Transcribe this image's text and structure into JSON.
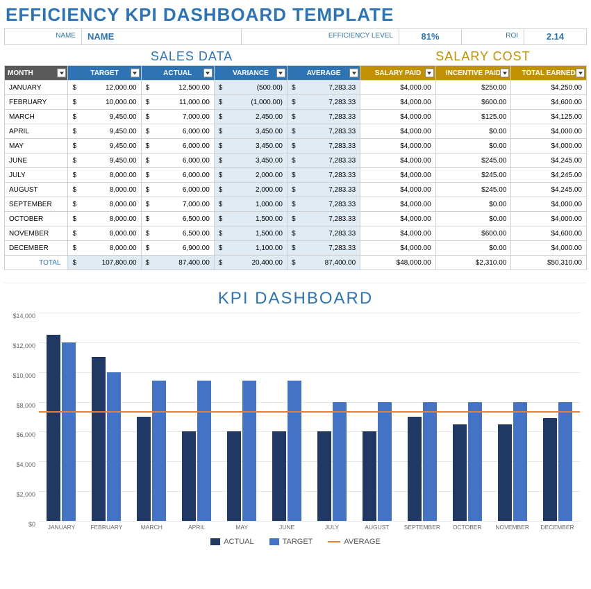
{
  "title": "EFFICIENCY KPI DASHBOARD TEMPLATE",
  "info": {
    "name_label": "NAME",
    "name_value": "NAME",
    "eff_label": "EFFICIENCY LEVEL",
    "eff_value": "81%",
    "roi_label": "ROI",
    "roi_value": "2.14"
  },
  "sections": {
    "sales": "SALES DATA",
    "salary": "SALARY COST"
  },
  "headers": {
    "month": "MONTH",
    "target": "TARGET",
    "actual": "ACTUAL",
    "variance": "VARIANCE",
    "average": "AVERAGE",
    "salary_paid": "SALARY PAID",
    "incentive": "INCENTIVE PAID",
    "total_earned": "TOTAL EARNED"
  },
  "rows": [
    {
      "month": "JANUARY",
      "target": "12,000.00",
      "actual": "12,500.00",
      "variance": "(500.00)",
      "average": "7,283.33",
      "salary": "$4,000.00",
      "incentive": "$250.00",
      "total": "$4,250.00"
    },
    {
      "month": "FEBRUARY",
      "target": "10,000.00",
      "actual": "11,000.00",
      "variance": "(1,000.00)",
      "average": "7,283.33",
      "salary": "$4,000.00",
      "incentive": "$600.00",
      "total": "$4,600.00"
    },
    {
      "month": "MARCH",
      "target": "9,450.00",
      "actual": "7,000.00",
      "variance": "2,450.00",
      "average": "7,283.33",
      "salary": "$4,000.00",
      "incentive": "$125.00",
      "total": "$4,125.00"
    },
    {
      "month": "APRIL",
      "target": "9,450.00",
      "actual": "6,000.00",
      "variance": "3,450.00",
      "average": "7,283.33",
      "salary": "$4,000.00",
      "incentive": "$0.00",
      "total": "$4,000.00"
    },
    {
      "month": "MAY",
      "target": "9,450.00",
      "actual": "6,000.00",
      "variance": "3,450.00",
      "average": "7,283.33",
      "salary": "$4,000.00",
      "incentive": "$0.00",
      "total": "$4,000.00"
    },
    {
      "month": "JUNE",
      "target": "9,450.00",
      "actual": "6,000.00",
      "variance": "3,450.00",
      "average": "7,283.33",
      "salary": "$4,000.00",
      "incentive": "$245.00",
      "total": "$4,245.00"
    },
    {
      "month": "JULY",
      "target": "8,000.00",
      "actual": "6,000.00",
      "variance": "2,000.00",
      "average": "7,283.33",
      "salary": "$4,000.00",
      "incentive": "$245.00",
      "total": "$4,245.00"
    },
    {
      "month": "AUGUST",
      "target": "8,000.00",
      "actual": "6,000.00",
      "variance": "2,000.00",
      "average": "7,283.33",
      "salary": "$4,000.00",
      "incentive": "$245.00",
      "total": "$4,245.00"
    },
    {
      "month": "SEPTEMBER",
      "target": "8,000.00",
      "actual": "7,000.00",
      "variance": "1,000.00",
      "average": "7,283.33",
      "salary": "$4,000.00",
      "incentive": "$0.00",
      "total": "$4,000.00"
    },
    {
      "month": "OCTOBER",
      "target": "8,000.00",
      "actual": "6,500.00",
      "variance": "1,500.00",
      "average": "7,283.33",
      "salary": "$4,000.00",
      "incentive": "$0.00",
      "total": "$4,000.00"
    },
    {
      "month": "NOVEMBER",
      "target": "8,000.00",
      "actual": "6,500.00",
      "variance": "1,500.00",
      "average": "7,283.33",
      "salary": "$4,000.00",
      "incentive": "$600.00",
      "total": "$4,600.00"
    },
    {
      "month": "DECEMBER",
      "target": "8,000.00",
      "actual": "6,900.00",
      "variance": "1,100.00",
      "average": "7,283.33",
      "salary": "$4,000.00",
      "incentive": "$0.00",
      "total": "$4,000.00"
    }
  ],
  "totals": {
    "label": "TOTAL",
    "target": "107,800.00",
    "actual": "87,400.00",
    "variance": "20,400.00",
    "average": "87,400.00",
    "salary": "$48,000.00",
    "incentive": "$2,310.00",
    "total": "$50,310.00"
  },
  "chart_title": "KPI DASHBOARD",
  "chart_data": {
    "type": "bar",
    "categories": [
      "JANUARY",
      "FEBRUARY",
      "MARCH",
      "APRIL",
      "MAY",
      "JUNE",
      "JULY",
      "AUGUST",
      "SEPTEMBER",
      "OCTOBER",
      "NOVEMBER",
      "DECEMBER"
    ],
    "series": [
      {
        "name": "ACTUAL",
        "values": [
          12500,
          11000,
          7000,
          6000,
          6000,
          6000,
          6000,
          6000,
          7000,
          6500,
          6500,
          6900
        ],
        "color": "#203864"
      },
      {
        "name": "TARGET",
        "values": [
          12000,
          10000,
          9450,
          9450,
          9450,
          9450,
          8000,
          8000,
          8000,
          8000,
          8000,
          8000
        ],
        "color": "#4472C4"
      },
      {
        "name": "AVERAGE",
        "type": "line",
        "values": [
          7283.33,
          7283.33,
          7283.33,
          7283.33,
          7283.33,
          7283.33,
          7283.33,
          7283.33,
          7283.33,
          7283.33,
          7283.33,
          7283.33
        ],
        "color": "#ED7D31"
      }
    ],
    "ylabel": "",
    "xlabel": "",
    "ylim": [
      0,
      14000
    ],
    "yticks": [
      0,
      2000,
      4000,
      6000,
      8000,
      10000,
      12000,
      14000
    ],
    "ytick_labels": [
      "$0",
      "$2,000",
      "$4,000",
      "$6,000",
      "$8,000",
      "$10,000",
      "$12,000",
      "$14,000"
    ]
  },
  "legend": {
    "actual": "ACTUAL",
    "target": "TARGET",
    "average": "AVERAGE"
  }
}
